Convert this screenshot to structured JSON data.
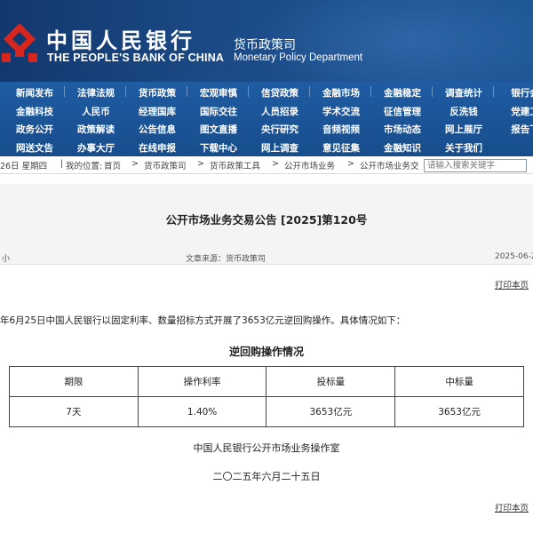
{
  "header": {
    "bank_name_cn": "中国人民银行",
    "bank_name_en": "THE PEOPLE'S BANK OF CHINA",
    "department_cn": "货币政策司",
    "department_en": "Monetary Policy Department",
    "logo_icon": "pboc-emblem-icon",
    "colors": {
      "header_bg": "#1b4a86",
      "nav_bg": "#1f5ca2",
      "logo_red": "#d7261e"
    }
  },
  "nav": {
    "rows": [
      [
        "新闻发布",
        "法律法规",
        "货币政策",
        "宏观审慎",
        "信贷政策",
        "金融市场",
        "金融稳定",
        "调查统计",
        "银行会"
      ],
      [
        "金融科技",
        "人民币",
        "经理国库",
        "国际交往",
        "人员招录",
        "学术交流",
        "征信管理",
        "反洗钱",
        "党建工"
      ],
      [
        "政务公开",
        "政策解读",
        "公告信息",
        "图文直播",
        "央行研究",
        "音频视频",
        "市场动态",
        "网上展厅",
        "报告下"
      ],
      [
        "网送文告",
        "办事大厅",
        "在线申报",
        "下载中心",
        "网上调查",
        "意见征集",
        "金融知识",
        "关于我们"
      ]
    ]
  },
  "breadcrumb": {
    "date": "26日 星期四",
    "location_label": "我的位置:",
    "items": [
      "首页",
      "货币政策司",
      "货币政策工具",
      "公开市场业务",
      "公开市场业务交"
    ],
    "separator": ">",
    "search_placeholder": "请输入搜索关键字"
  },
  "article": {
    "title": "公开市场业务交易公告 [2025]第120号",
    "font_size_label": "小",
    "source_label": "文章来源：货币政策司",
    "date": "2025-06-2",
    "print_label": "打印本页",
    "body": "年6月25日中国人民银行以固定利率、数量招标方式开展了3653亿元逆回购操作。具体情况如下：",
    "table_caption": "逆回购操作情况",
    "table": {
      "headers": [
        "期限",
        "操作利率",
        "投标量",
        "中标量"
      ],
      "rows": [
        [
          "7天",
          "1.40%",
          "3653亿元",
          "3653亿元"
        ]
      ]
    },
    "signature_org": "中国人民银行公开市场业务操作室",
    "signature_date": "二〇二五年六月二十五日"
  }
}
